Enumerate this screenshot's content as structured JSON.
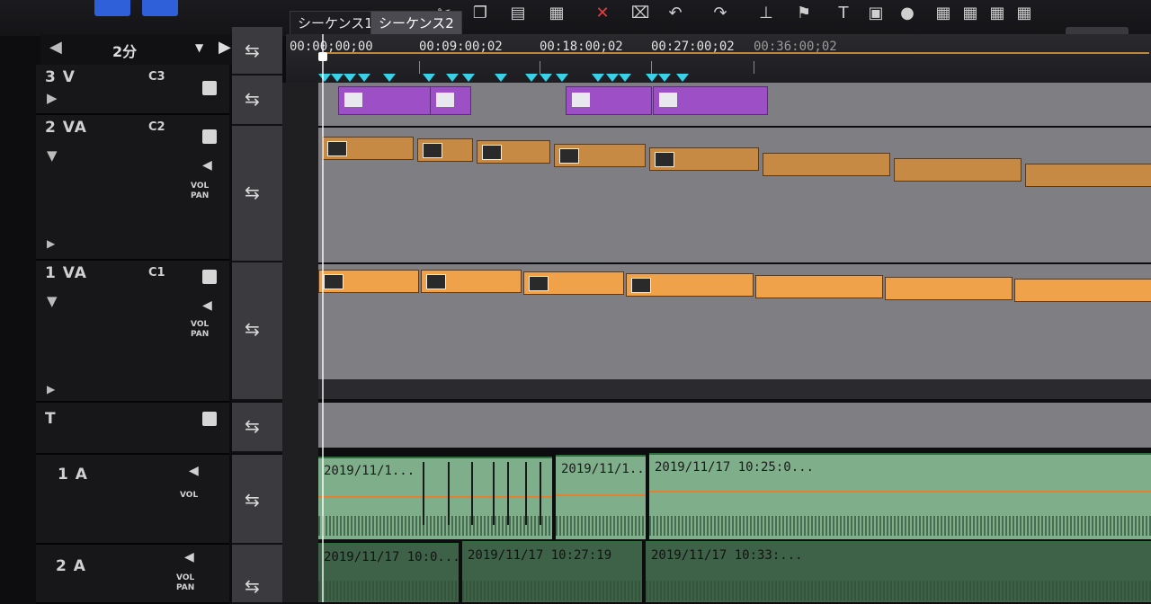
{
  "tabs": [
    "シーケンス1",
    "シーケンス2"
  ],
  "zoom": {
    "label": "2分"
  },
  "ruler": {
    "timecodes": [
      "00:00;00;00",
      "00:09:00;02",
      "00:18:00;02",
      "00:27:00;02",
      "00:36:00;02"
    ]
  },
  "tracks": [
    {
      "name": "3 V",
      "channel": "C3"
    },
    {
      "name": "2 VA",
      "channel": "C2",
      "vol": "VOL",
      "pan": "PAN"
    },
    {
      "name": "1 VA",
      "channel": "C1",
      "vol": "VOL",
      "pan": "PAN"
    },
    {
      "name": "T"
    },
    {
      "name": "1 A",
      "vol": "VOL"
    },
    {
      "name": "2 A",
      "vol": "VOL",
      "pan": "PAN"
    }
  ],
  "audio_clips": {
    "a1": [
      "2019/11/1...",
      "2019/11/1...",
      "2019/11/17 10:25:0..."
    ],
    "a2": [
      "2019/11/17 10:0...",
      "2019/11/17 10:27:19",
      "2019/11/17 10:33:..."
    ]
  },
  "colors": {
    "accent": "#2f5fd9",
    "marker": "#3ad0e6",
    "clip_video": "#9d4fc6",
    "clip_av": "#c68a45",
    "clip_audio": "#7fae8a"
  }
}
